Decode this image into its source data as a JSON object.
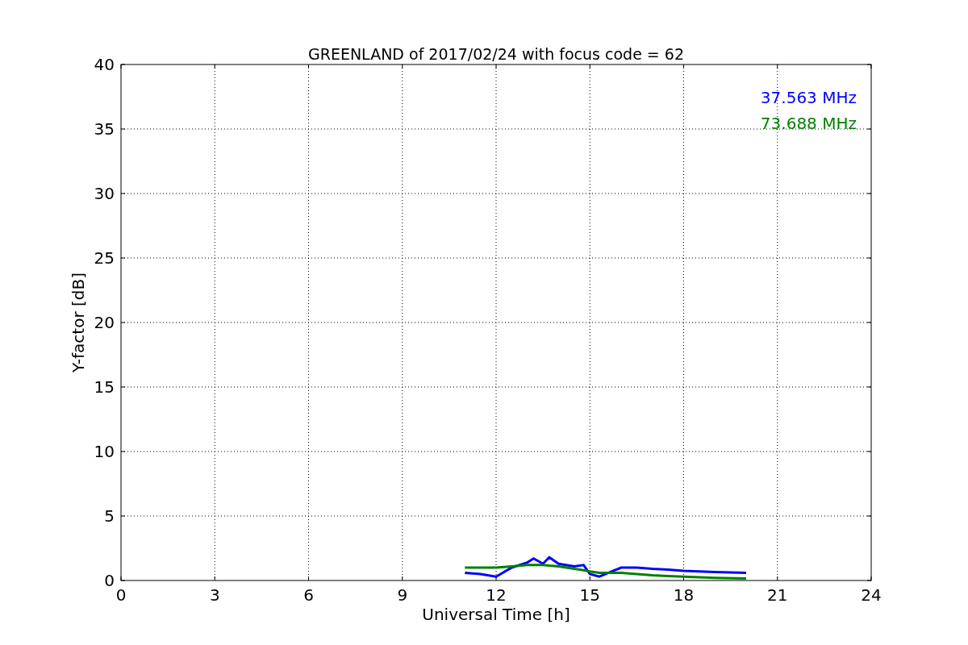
{
  "figure": {
    "chart_data": {
      "type": "line",
      "title": "GREENLAND of 2017/02/24 with focus code = 62",
      "xlabel": "Universal Time [h]",
      "ylabel": "Y-factor [dB]",
      "x": [
        11,
        11.5,
        12,
        12.5,
        13,
        13.2,
        13.5,
        13.7,
        14,
        14.5,
        14.8,
        15,
        15.3,
        15.6,
        16,
        16.5,
        17,
        17.5,
        18,
        19,
        20
      ],
      "series": [
        {
          "name": "37.563 MHz",
          "color": "#0000ff",
          "values": [
            0.6,
            0.5,
            0.3,
            1.0,
            1.4,
            1.7,
            1.3,
            1.8,
            1.3,
            1.1,
            1.2,
            0.5,
            0.3,
            0.6,
            1.0,
            1.0,
            0.9,
            0.85,
            0.75,
            0.65,
            0.6
          ]
        },
        {
          "name": "73.688 MHz",
          "color": "#008000",
          "values": [
            1.0,
            1.0,
            1.0,
            1.1,
            1.2,
            1.2,
            1.2,
            1.15,
            1.1,
            0.9,
            0.8,
            0.7,
            0.6,
            0.6,
            0.6,
            0.5,
            0.4,
            0.35,
            0.3,
            0.2,
            0.15
          ]
        }
      ],
      "grid": true,
      "xlim": [
        0,
        24
      ],
      "ylim": [
        0,
        40
      ],
      "xticks": [
        0,
        3,
        6,
        9,
        12,
        15,
        18,
        21,
        24
      ],
      "yticks": [
        0,
        5,
        10,
        15,
        20,
        25,
        30,
        35,
        40
      ]
    }
  }
}
